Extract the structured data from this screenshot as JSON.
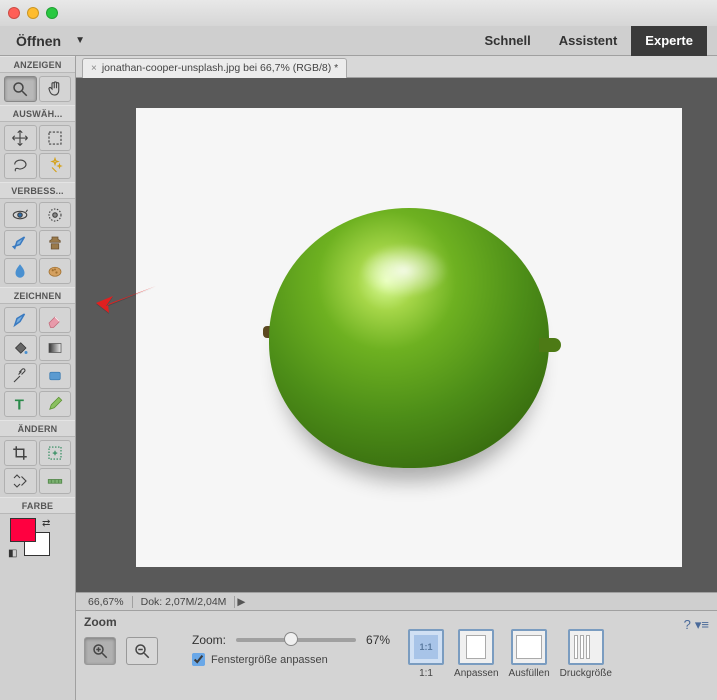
{
  "topbar": {
    "open_label": "Öffnen",
    "modes": {
      "schnell": "Schnell",
      "assistent": "Assistent",
      "experte": "Experte"
    }
  },
  "documentTab": {
    "title": "jonathan-cooper-unsplash.jpg bei 66,7% (RGB/8) *"
  },
  "toolSections": {
    "anzeigen": "ANZEIGEN",
    "auswaehlen": "AUSWÄH...",
    "verbessern": "VERBESS...",
    "zeichnen": "ZEICHNEN",
    "aendern": "ÄNDERN",
    "farbe": "FARBE"
  },
  "tools": {
    "zoom": "zoom-tool",
    "hand": "hand-tool",
    "move": "move-tool",
    "marquee": "rectangular-marquee-tool",
    "lasso": "lasso-tool",
    "magicwand": "magic-wand-tool",
    "eye": "redeye-tool",
    "healing": "spot-healing-tool",
    "smartbrush": "smart-brush-tool",
    "clone": "clone-stamp-tool",
    "blur": "blur-tool",
    "sponge": "sponge-tool",
    "brush": "brush-tool",
    "eraser": "eraser-tool",
    "paintbucket": "paint-bucket-tool",
    "gradient": "gradient-tool",
    "eyedropper": "eyedropper-tool",
    "shape": "shape-tool",
    "type": "type-tool",
    "pencil": "pencil-tool",
    "crop": "crop-tool",
    "recompose": "recompose-tool",
    "straighten": "straighten-tool",
    "contentaware": "content-aware-tool"
  },
  "colors": {
    "foreground": "#ff0040",
    "background": "#ffffff"
  },
  "status": {
    "zoom_pct": "66,67%",
    "doc_info": "Dok: 2,07M/2,04M"
  },
  "options": {
    "title": "Zoom",
    "zoom_label": "Zoom:",
    "zoom_value": "67%",
    "fit_window": "Fenstergröße anpassen",
    "fitbtns": {
      "one_to_one": "1:1",
      "anpassen": "Anpassen",
      "ausfuellen": "Ausfüllen",
      "druckgroesse": "Druckgröße"
    }
  }
}
